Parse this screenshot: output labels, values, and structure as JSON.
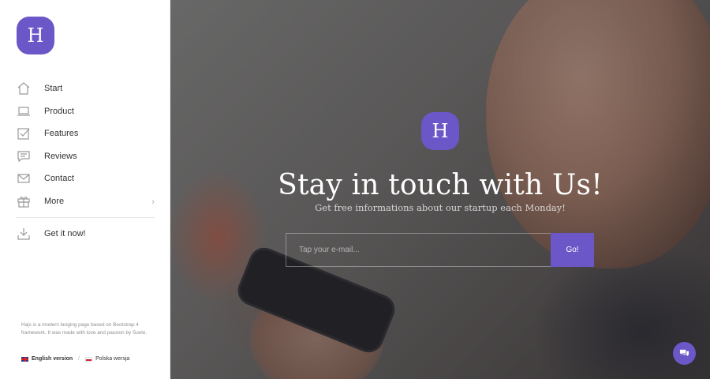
{
  "brand": {
    "logo_letter": "H",
    "accent": "#6b57c7"
  },
  "sidebar": {
    "items": [
      {
        "label": "Start",
        "icon": "home-icon"
      },
      {
        "label": "Product",
        "icon": "laptop-icon"
      },
      {
        "label": "Features",
        "icon": "checkbox-icon"
      },
      {
        "label": "Reviews",
        "icon": "comment-icon"
      },
      {
        "label": "Contact",
        "icon": "envelope-icon"
      },
      {
        "label": "More",
        "icon": "gift-icon",
        "chevron": "›"
      }
    ],
    "cta": {
      "label": "Get it now!",
      "icon": "download-icon"
    },
    "about": "Hajs is a modern langing page based on Bootstrap 4 framework. It was made with love and passion by Suelo.",
    "languages": [
      {
        "label": "English version",
        "flag": "uk"
      },
      {
        "label": "Polska wersja",
        "flag": "pl"
      }
    ],
    "lang_separator": "/"
  },
  "hero": {
    "logo_letter": "H",
    "headline": "Stay in touch with Us!",
    "subline": "Get free informations about our startup each Monday!",
    "email_placeholder": "Tap your e-mail...",
    "submit_label": "Go!"
  },
  "chat": {
    "icon": "chat-bubbles-icon"
  }
}
